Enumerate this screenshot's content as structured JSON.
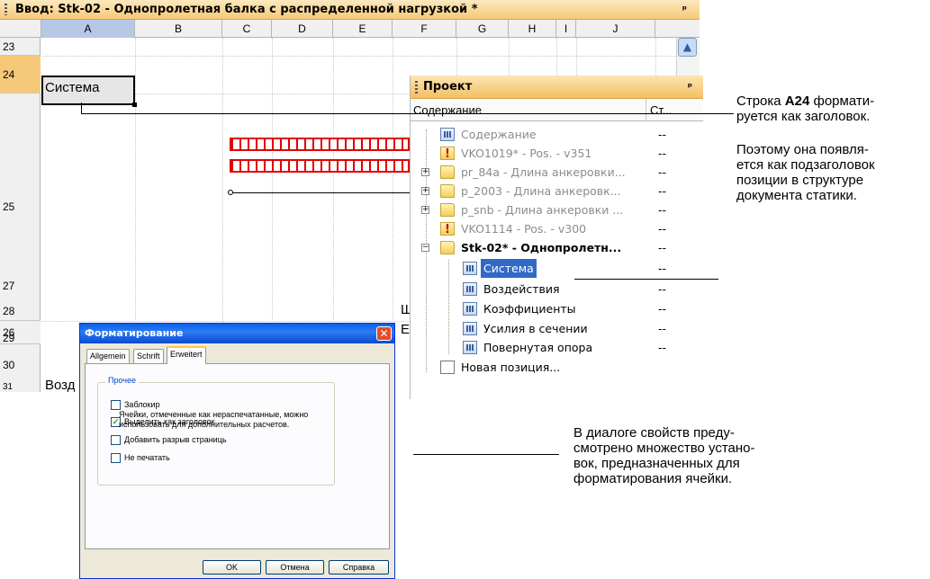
{
  "sheet": {
    "title": "Ввод: Stk-02 - Однопролетная балка с распределенной нагрузкой *",
    "pin": "ᵖ",
    "columns": [
      "A",
      "B",
      "C",
      "D",
      "E",
      "F",
      "G",
      "H",
      "I",
      "J"
    ],
    "rows": [
      "23",
      "24",
      "25",
      "26",
      "27",
      "28",
      "29",
      "30",
      "31"
    ],
    "cell_a24": "Система",
    "row31_text": "Возд",
    "cut_f28": "Щ",
    "cut_f29": "Е"
  },
  "project": {
    "title": "Проект",
    "pin": "ᵖ",
    "col_content": "Содержание",
    "col_status": "Ст...",
    "items": [
      {
        "label": "Содержание",
        "status": "--"
      },
      {
        "label": "VKO1019* - Pos. - v351",
        "status": "--"
      },
      {
        "label": "pr_84a - Длина анкеровки...",
        "status": "--"
      },
      {
        "label": "p_2003 - Длина анкеровк...",
        "status": "--"
      },
      {
        "label": "p_snb - Длина анкеровки ...",
        "status": "--"
      },
      {
        "label": "VKO1114 - Pos. - v300",
        "status": "--"
      },
      {
        "label": "Stk-02* - Однопролетн...",
        "status": "--"
      },
      {
        "label": "Система",
        "status": "--"
      },
      {
        "label": "Воздействия",
        "status": "--"
      },
      {
        "label": "Коэффициенты",
        "status": "--"
      },
      {
        "label": "Усилия в сечении",
        "status": "--"
      },
      {
        "label": "Повернутая опора",
        "status": "--"
      },
      {
        "label": "Новая позиция...",
        "status": ""
      }
    ]
  },
  "dialog": {
    "title": "Форматирование",
    "tabs": [
      "Allgemein",
      "Schrift",
      "Erweitert"
    ],
    "group_title": "Прочее",
    "options": [
      {
        "label": "Заблокир",
        "checked": false,
        "mark": ""
      },
      {
        "label": "Выделить как заголовок",
        "checked": true,
        "mark": "✓"
      },
      {
        "label": "Добавить разрыв страниць",
        "checked": false,
        "mark": ""
      },
      {
        "label": "Не печатать",
        "checked": false,
        "mark": ""
      }
    ],
    "note": "Ячейки, отмеченные как нераспечатанные, можно использовать для дополнительных расчетов.",
    "buttons": {
      "ok": "OK",
      "cancel": "Отмена",
      "help": "Справка"
    }
  },
  "annotations": {
    "a24_pre": "Строка ",
    "a24_bold": "A24",
    "a24_post": " формати-",
    "a24_line2": "руется как заголовок.",
    "a24_detail": [
      "Поэтому она появля-",
      "ется как подзаголовок",
      "позиции в структуре",
      "документа статики."
    ],
    "dialog_note": [
      "В диалоге свойств преду-",
      "смотрено множество устано-",
      "вок, предназначенных для",
      "форматирования ячейки."
    ]
  }
}
